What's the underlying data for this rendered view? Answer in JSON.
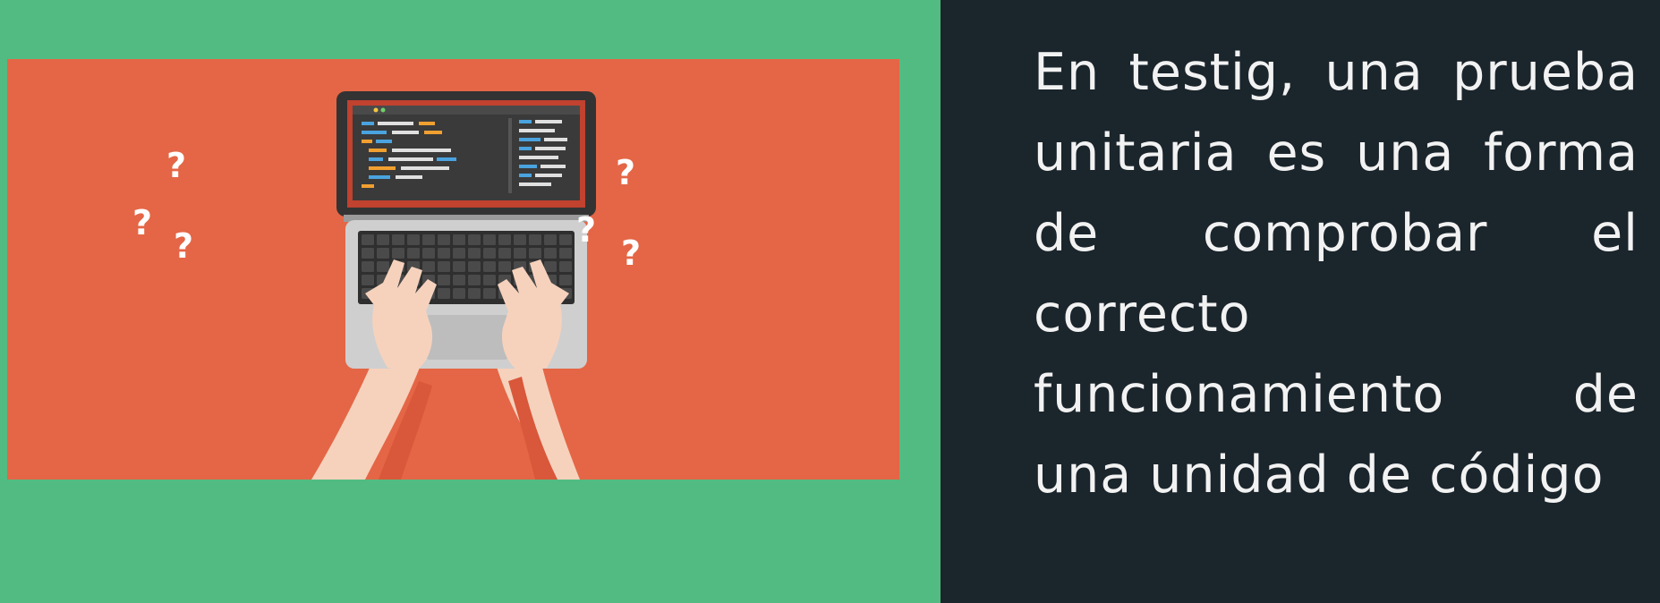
{
  "caption": {
    "text": "En testig, una prueba unitaria es una forma de comprobar el correcto funcionamiento de una unidad de código"
  },
  "illustration": {
    "question_mark": "?",
    "colors": {
      "page_background": "#52bb82",
      "illustration_background": "#e46646",
      "text_panel_background": "#1b252c",
      "text_color": "#f2f2f2",
      "laptop_body": "#cfcfcf",
      "laptop_screen_frame": "#333333",
      "screen_inner": "#c0422f",
      "skin": "#f6d2bd"
    },
    "icons": [
      "laptop-icon",
      "hands-icon",
      "question-mark-icon"
    ]
  }
}
